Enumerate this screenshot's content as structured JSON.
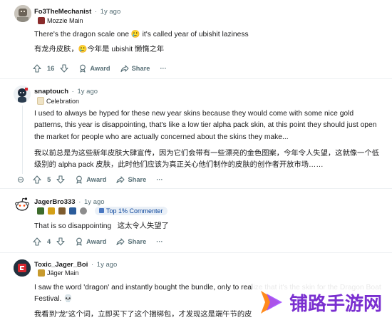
{
  "comments": [
    {
      "username": "Fo3TheMechanist",
      "time": "1y ago",
      "flair": "Mozzie Main",
      "paragraphs": [
        "There's the dragon scale one 🥲 it's called year of ubishit laziness",
        "有龙舟皮肤，🥲今年是 ubishit 懒惰之年"
      ],
      "votes": "16",
      "award_label": "Award",
      "share_label": "Share",
      "more_label": "···"
    },
    {
      "username": "snaptouch",
      "time": "1y ago",
      "flair": "Celebration",
      "paragraphs": [
        "I used to always be hyped for these new year skins because they would come with some nice gold patterns, this year is disappointing, that's like a low tier alpha pack skin, at this point they should just open the market for people who are actually concerned about the skins they make...",
        "我以前总是为这些新年皮肤大肆宣传，因为它们会带有一些漂亮的金色图案，今年令人失望，这就像一个低级别的 alpha pack 皮肤，此时他们应该为真正关心他们制作的皮肤的创作者开放市场……"
      ],
      "votes": "5",
      "award_label": "Award",
      "share_label": "Share",
      "more_label": "···",
      "collapse_icon": "⊖"
    },
    {
      "username": "JagerBro333",
      "time": "1y ago",
      "top_badge": "Top 1% Commenter",
      "paragraphs": [
        "That is so disappointing   这太令人失望了"
      ],
      "votes": "4",
      "award_label": "Award",
      "share_label": "Share",
      "more_label": "···"
    },
    {
      "username": "Toxic_Jager_Boi",
      "time": "1y ago",
      "flair": "Jäger Main",
      "paragraphs": [
        "I saw the word 'dragon' and instantly bought the bundle, only to realize that it's the skin for the Dragon Boat Festival. 💀",
        "我看到“龙”这个词，立即买下了这个捆绑包，才发现这是端午节的皮"
      ]
    }
  ],
  "watermark": {
    "text": "铺路手游网",
    "colors": {
      "text": "#7a2fd0",
      "logo_a": "#ff8a1c",
      "logo_b": "#a24dff"
    }
  },
  "colors": {
    "meta": "#576f76",
    "badge_bg": "#eaf0f7",
    "badge_text": "#0a449b"
  }
}
